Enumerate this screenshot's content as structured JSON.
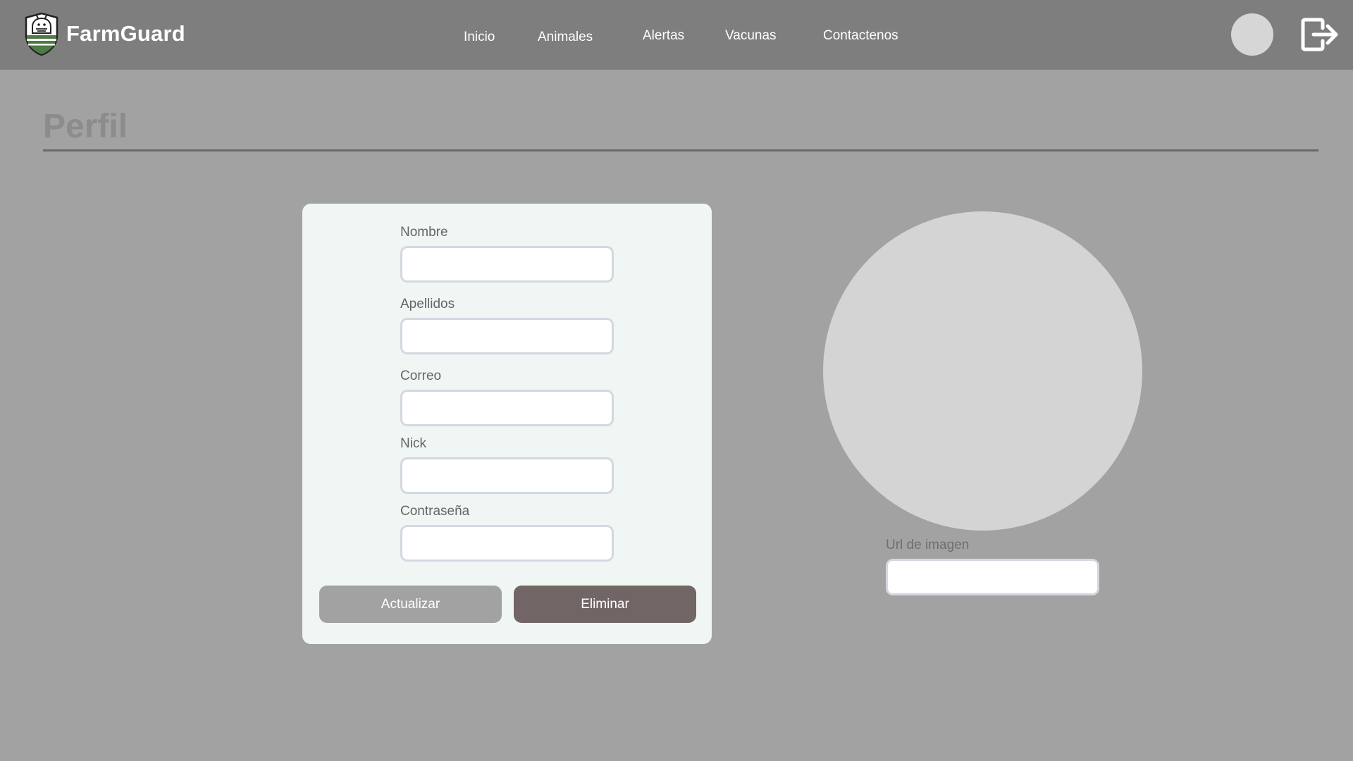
{
  "brand": {
    "name": "FarmGuard",
    "logo_icon": "farm-shield-logo-icon"
  },
  "nav": {
    "items": [
      {
        "label": "Inicio"
      },
      {
        "label": "Animales"
      },
      {
        "label": "Alertas"
      },
      {
        "label": "Vacunas"
      },
      {
        "label": "Contactenos"
      }
    ],
    "avatar_icon": "user-avatar",
    "logout_icon": "logout-icon"
  },
  "page": {
    "title": "Perfil"
  },
  "form": {
    "fields": [
      {
        "label": "Nombre",
        "value": "",
        "placeholder": ""
      },
      {
        "label": "Apellidos",
        "value": "",
        "placeholder": ""
      },
      {
        "label": "Correo",
        "value": "",
        "placeholder": ""
      },
      {
        "label": "Nick",
        "value": "",
        "placeholder": ""
      },
      {
        "label": "Contraseña",
        "value": "",
        "placeholder": ""
      }
    ],
    "update_label": "Actualizar",
    "delete_label": "Eliminar"
  },
  "image": {
    "url_label": "Url de imagen",
    "url_value": ""
  },
  "colors": {
    "navbar_bg": "#7e7e7e",
    "page_bg": "#a2a2a2",
    "card_bg": "#f0f6f4",
    "update_button": "#a2a2a2",
    "delete_button": "#726565",
    "photo_placeholder": "#d4d4d4"
  }
}
